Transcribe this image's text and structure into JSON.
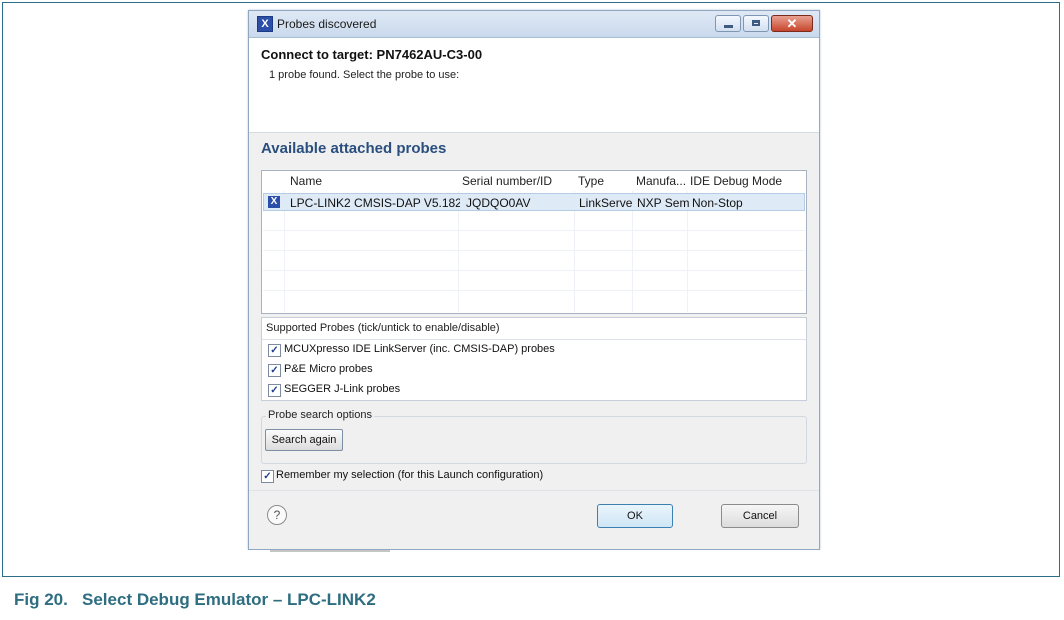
{
  "dialog": {
    "title": "Probes discovered",
    "app_icon": "X",
    "close_glyph": "✕",
    "header_title": "Connect to target: PN7462AU-C3-00",
    "header_subtitle": "1 probe found. Select the probe to use:",
    "section_title": "Available attached probes"
  },
  "probes_table": {
    "columns": [
      "Name",
      "Serial number/ID",
      "Type",
      "Manufa...",
      "IDE Debug Mode"
    ],
    "rows": [
      {
        "name": "LPC-LINK2 CMSIS-DAP V5.182",
        "serial": "JQDQO0AV",
        "type": "LinkServe",
        "manufacturer": "NXP Sem",
        "ide_debug_mode": "Non-Stop",
        "selected": true
      }
    ]
  },
  "supported_probes": {
    "title": "Supported Probes (tick/untick to enable/disable)",
    "items": [
      {
        "label": "MCUXpresso IDE LinkServer (inc. CMSIS-DAP) probes",
        "checked": true
      },
      {
        "label": "P&E Micro probes",
        "checked": true
      },
      {
        "label": "SEGGER J-Link probes",
        "checked": true
      }
    ]
  },
  "search_options": {
    "legend": "Probe search options",
    "button_label": "Search again"
  },
  "remember": {
    "label": "Remember my selection (for this Launch configuration)",
    "checked": true
  },
  "footer": {
    "help_glyph": "?",
    "ok_label": "OK",
    "cancel_label": "Cancel"
  },
  "checkmark": "✓",
  "caption": "Fig 20.   Select Debug Emulator – LPC-LINK2",
  "colors": {
    "section_title": "#2a4f7e",
    "caption": "#2e6e80",
    "selection": "#dfeaf7"
  }
}
